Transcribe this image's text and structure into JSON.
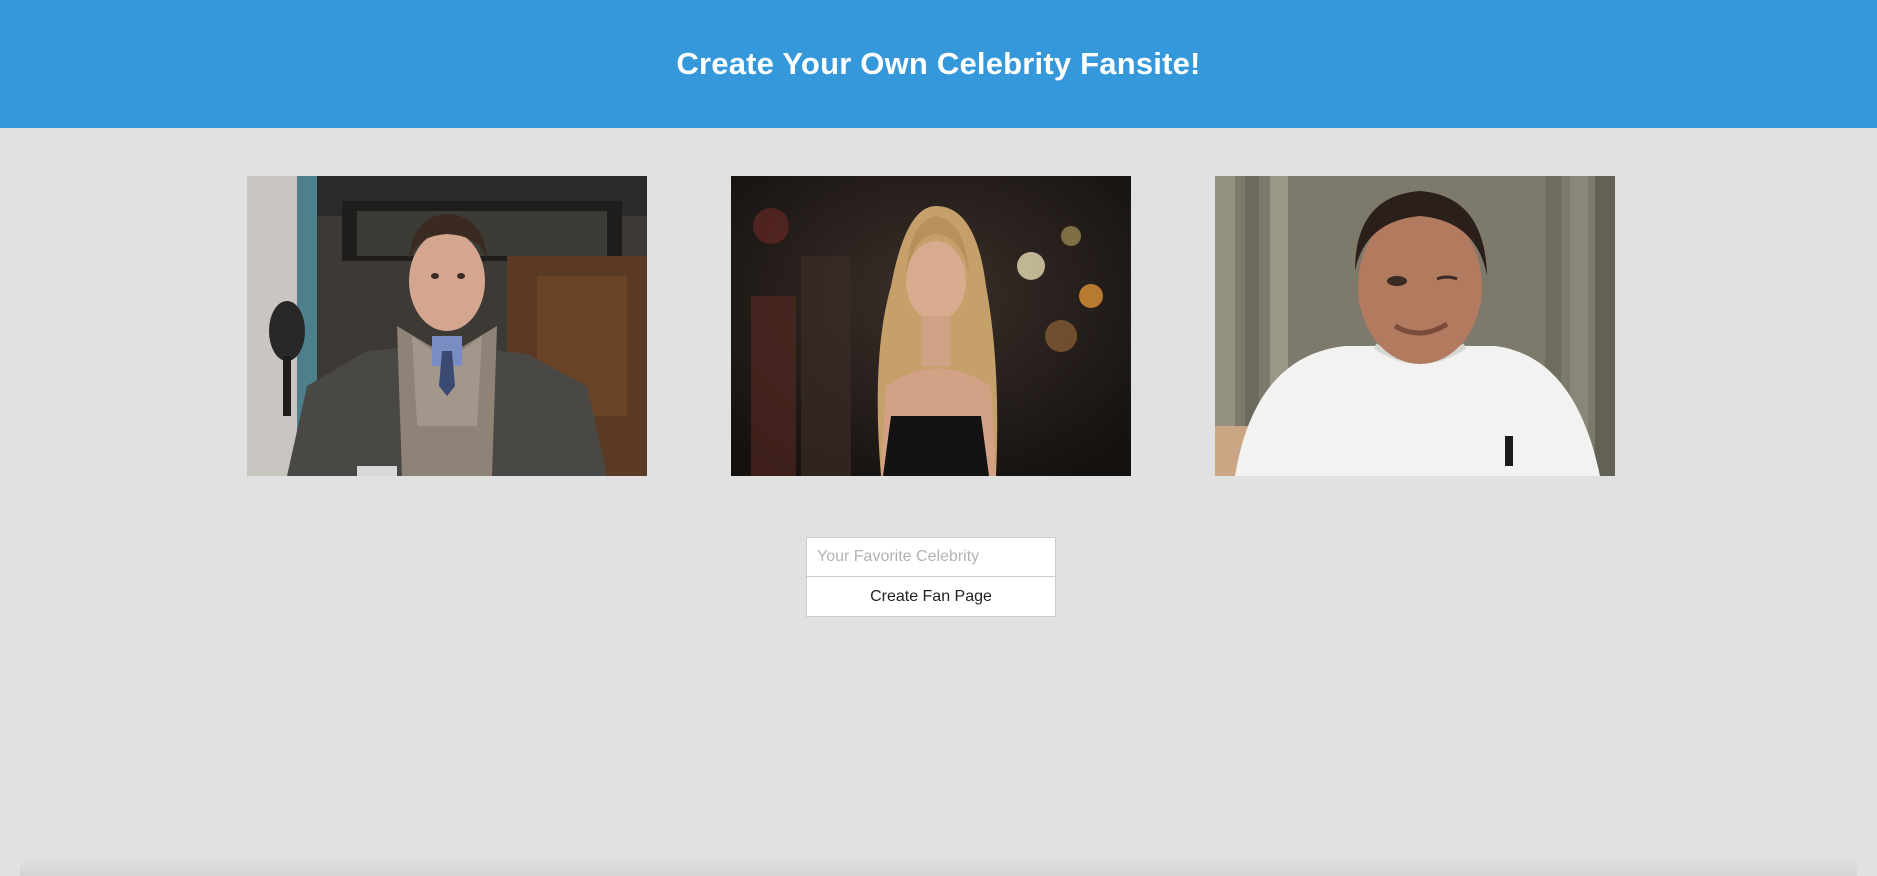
{
  "header": {
    "title": "Create Your Own Celebrity Fansite!",
    "background_color": "#3498db"
  },
  "gallery": {
    "photos": [
      {
        "name": "celebrity-photo-1"
      },
      {
        "name": "celebrity-photo-2"
      },
      {
        "name": "celebrity-photo-3"
      }
    ]
  },
  "form": {
    "input_value": "",
    "input_placeholder": "Your Favorite Celebrity",
    "submit_label": "Create Fan Page"
  },
  "page": {
    "background_color": "#e1e1e1"
  }
}
